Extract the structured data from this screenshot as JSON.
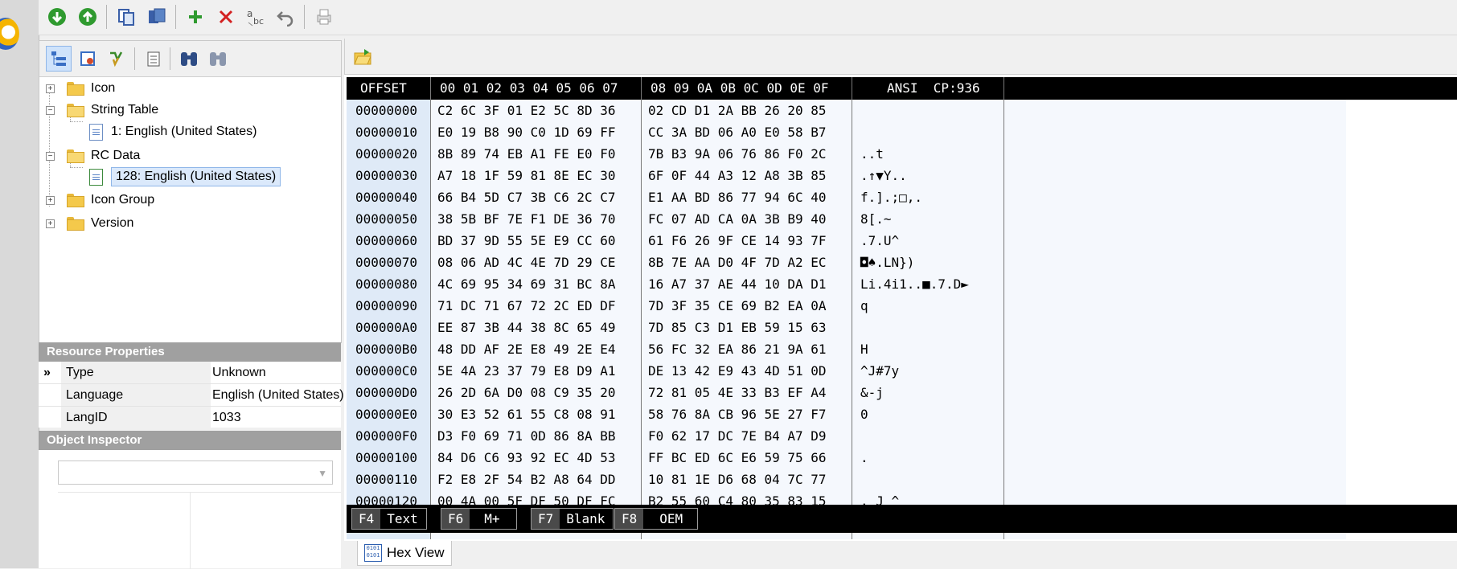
{
  "toolbar": {
    "buttons": [
      "go-down-icon",
      "go-up-icon",
      "copy-icon",
      "copy-all-icon",
      "add-icon",
      "delete-icon",
      "rename-icon",
      "undo-icon",
      "print-icon"
    ]
  },
  "tree_toolbar": {
    "buttons": [
      "tree-view-icon",
      "resource-view-icon",
      "filter-icon",
      "checked-list-icon",
      "find-icon",
      "find-next-icon"
    ]
  },
  "tree": {
    "items": [
      {
        "label": "Icon"
      },
      {
        "label": "String Table"
      },
      {
        "label": "1: English (United States)"
      },
      {
        "label": "RC Data"
      },
      {
        "label": "128: English (United States)"
      },
      {
        "label": "Icon Group"
      },
      {
        "label": "Version"
      }
    ]
  },
  "resource_properties": {
    "header": "Resource Properties",
    "rows": [
      {
        "key": "Type",
        "value": "Unknown"
      },
      {
        "key": "Language",
        "value": "English (United States)"
      },
      {
        "key": "LangID",
        "value": "1033"
      }
    ]
  },
  "object_inspector": {
    "header": "Object Inspector",
    "value": ""
  },
  "hex": {
    "header": {
      "offset": "OFFSET",
      "cols1": "00 01 02 03 04 05 06 07",
      "cols2": "08 09 0A 0B 0C 0D 0E 0F",
      "ansi": "ANSI  CP:936"
    },
    "rows": [
      {
        "offset": "00000000",
        "b1": "C2 6C 3F 01 E2 5C 8D 36",
        "b2": "02 CD D1 2A BB 26 20 85",
        "ansi": ""
      },
      {
        "offset": "00000010",
        "b1": "E0 19 B8 90 C0 1D 69 FF",
        "b2": "CC 3A BD 06 A0 E0 58 B7",
        "ansi": ""
      },
      {
        "offset": "00000020",
        "b1": "8B 89 74 EB A1 FE E0 F0",
        "b2": "7B B3 9A 06 76 86 F0 2C",
        "ansi": "..t"
      },
      {
        "offset": "00000030",
        "b1": "A7 18 1F 59 81 8E EC 30",
        "b2": "6F 0F 44 A3 12 A8 3B 85",
        "ansi": ".↑▼Y.."
      },
      {
        "offset": "00000040",
        "b1": "66 B4 5D C7 3B C6 2C C7",
        "b2": "E1 AA BD 86 77 94 6C 40",
        "ansi": "f.].;□,."
      },
      {
        "offset": "00000050",
        "b1": "38 5B BF 7E F1 DE 36 70",
        "b2": "FC 07 AD CA 0A 3B B9 40",
        "ansi": "8[.~"
      },
      {
        "offset": "00000060",
        "b1": "BD 37 9D 55 5E E9 CC 60",
        "b2": "61 F6 26 9F CE 14 93 7F",
        "ansi": ".7.U^"
      },
      {
        "offset": "00000070",
        "b1": "08 06 AD 4C 4E 7D 29 CE",
        "b2": "8B 7E AA D0 4F 7D A2 EC",
        "ansi": "◘♠.LN})"
      },
      {
        "offset": "00000080",
        "b1": "4C 69 95 34 69 31 BC 8A",
        "b2": "16 A7 37 AE 44 10 DA D1",
        "ansi": "Li.4i1..■.7.D►"
      },
      {
        "offset": "00000090",
        "b1": "71 DC 71 67 72 2C ED DF",
        "b2": "7D 3F 35 CE 69 B2 EA 0A",
        "ansi": "q"
      },
      {
        "offset": "000000A0",
        "b1": "EE 87 3B 44 38 8C 65 49",
        "b2": "7D 85 C3 D1 EB 59 15 63",
        "ansi": ""
      },
      {
        "offset": "000000B0",
        "b1": "48 DD AF 2E E8 49 2E E4",
        "b2": "56 FC 32 EA 86 21 9A 61",
        "ansi": "H"
      },
      {
        "offset": "000000C0",
        "b1": "5E 4A 23 37 79 E8 D9 A1",
        "b2": "DE 13 42 E9 43 4D 51 0D",
        "ansi": "^J#7y"
      },
      {
        "offset": "000000D0",
        "b1": "26 2D 6A D0 08 C9 35 20",
        "b2": "72 81 05 4E 33 B3 EF A4",
        "ansi": "&-j"
      },
      {
        "offset": "000000E0",
        "b1": "30 E3 52 61 55 C8 08 91",
        "b2": "58 76 8A CB 96 5E 27 F7",
        "ansi": "0"
      },
      {
        "offset": "000000F0",
        "b1": "D3 F0 69 71 0D 86 8A BB",
        "b2": "F0 62 17 DC 7E B4 A7 D9",
        "ansi": ""
      },
      {
        "offset": "00000100",
        "b1": "84 D6 C6 93 92 EC 4D 53",
        "b2": "FF BC ED 6C E6 59 75 66",
        "ansi": "."
      },
      {
        "offset": "00000110",
        "b1": "F2 E8 2F 54 B2 A8 64 DD",
        "b2": "10 81 1E D6 68 04 7C 77",
        "ansi": ""
      },
      {
        "offset": "00000120",
        "b1": "00 4A 00 5F DF 50 DF FC",
        "b2": "B2 55 60 C4 80 35 83 15",
        "ansi": ". J ^"
      }
    ],
    "function_keys": [
      {
        "key": "F4",
        "label": "Text"
      },
      {
        "key": "F6",
        "label": "M+"
      },
      {
        "key": "F7",
        "label": "Blank"
      },
      {
        "key": "F8",
        "label": "OEM"
      }
    ]
  },
  "tabs": {
    "hex_view": "Hex View",
    "hex_icon_text": "0101 0101"
  },
  "colors": {
    "offset_bg": "#dfeaf7",
    "header_bg": "#000000",
    "props_header": "#a0a0a0",
    "selection": "#dbe9fb"
  }
}
